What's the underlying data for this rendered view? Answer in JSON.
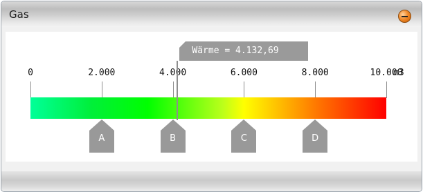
{
  "panel": {
    "title": "Gas",
    "collapse_icon": "minus-circle-icon",
    "accent_color": "#e8831a"
  },
  "scale": {
    "min": 0,
    "max": 10000,
    "unit": "m3",
    "ticks": [
      {
        "value": 0,
        "label": "0"
      },
      {
        "value": 2000,
        "label": "2.000"
      },
      {
        "value": 4000,
        "label": "4.000"
      },
      {
        "value": 6000,
        "label": "6.000"
      },
      {
        "value": 8000,
        "label": "8.000"
      },
      {
        "value": 10000,
        "label": "10.000"
      }
    ],
    "gradient_colors": [
      "#00ff99",
      "#00ff00",
      "#ffff00",
      "#ff7a00",
      "#ff0000"
    ]
  },
  "indicator": {
    "text": "Wärme = 4.132,69",
    "value": 4132.69
  },
  "markers": [
    {
      "label": "A",
      "value": 2000
    },
    {
      "label": "B",
      "value": 4000
    },
    {
      "label": "C",
      "value": 6000
    },
    {
      "label": "D",
      "value": 8000
    }
  ]
}
